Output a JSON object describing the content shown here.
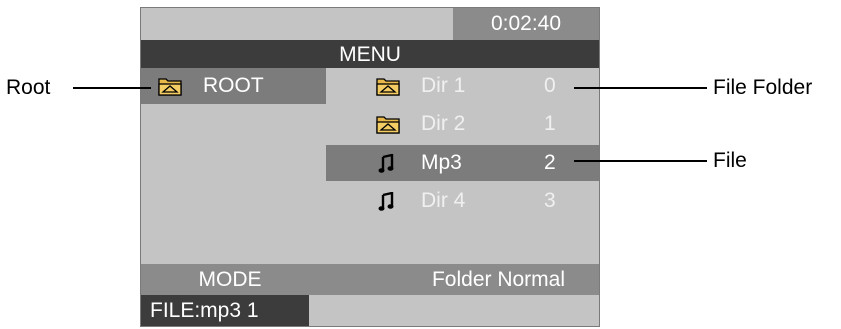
{
  "status": {
    "time": "0:02:40"
  },
  "header": {
    "menu_label": "MENU"
  },
  "root": {
    "label": "ROOT",
    "icon": "folder-icon"
  },
  "entries": [
    {
      "name": "Dir 1",
      "index": "0",
      "icon": "folder-icon",
      "selected": false
    },
    {
      "name": "Dir 2",
      "index": "1",
      "icon": "folder-icon",
      "selected": false
    },
    {
      "name": "Mp3",
      "index": "2",
      "icon": "music-note-icon",
      "selected": true
    },
    {
      "name": "Dir 4",
      "index": "3",
      "icon": "music-note-icon",
      "selected": false
    }
  ],
  "mode": {
    "label": "MODE",
    "value": "Folder Normal"
  },
  "file": {
    "label": "FILE:mp3 1"
  },
  "callouts": {
    "root": "Root",
    "file_folder": "File Folder",
    "file": "File"
  },
  "colors": {
    "screen_bg": "#c4c4c4",
    "dark_bar": "#3c3c3c",
    "mid_bar": "#8b8b8b",
    "highlight": "#7c7c7c",
    "folder_fill": "#e8b84a"
  }
}
